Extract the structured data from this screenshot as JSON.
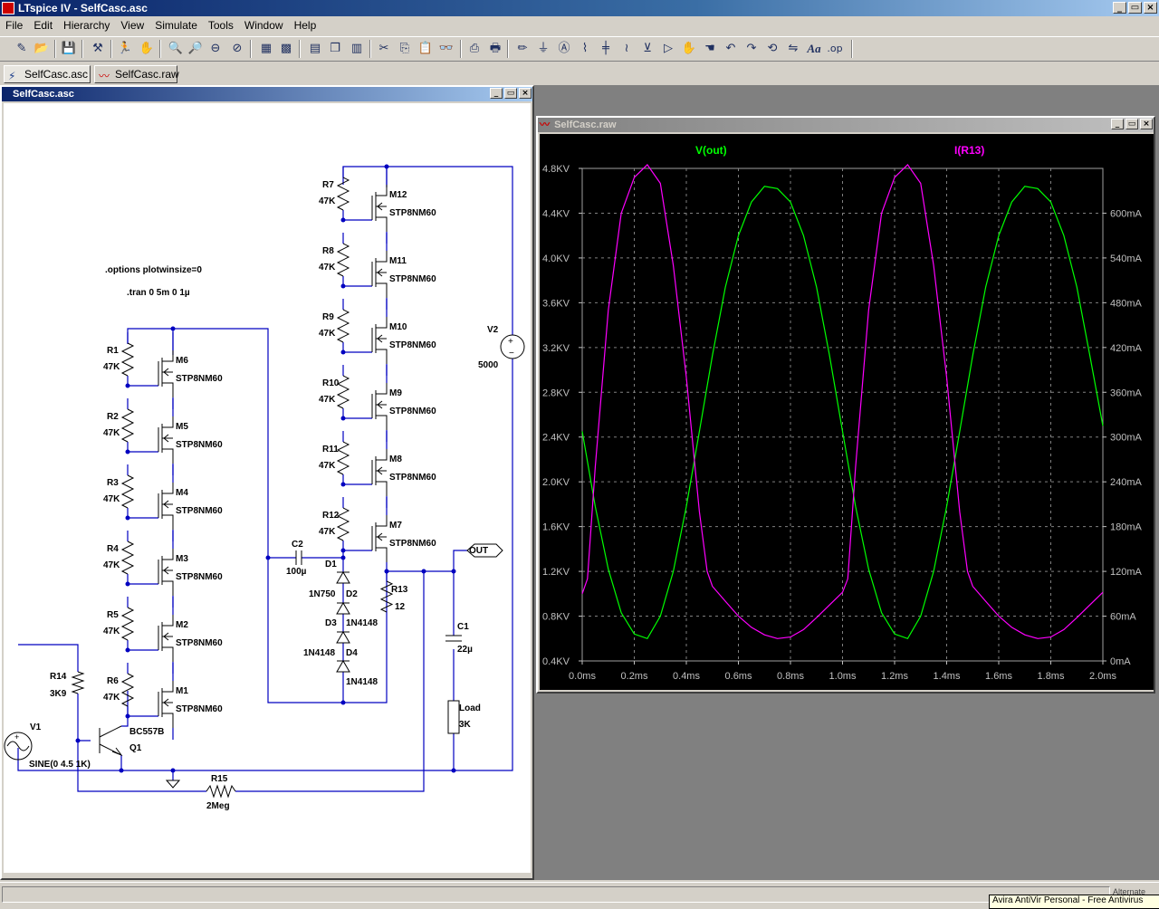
{
  "window": {
    "title": "LTspice IV - SelfCasc.asc",
    "controls": [
      "_",
      "▭",
      "×"
    ]
  },
  "menu": [
    "File",
    "Edit",
    "Hierarchy",
    "View",
    "Simulate",
    "Tools",
    "Window",
    "Help"
  ],
  "toolbar": {
    "buttons": [
      "new-schematic-icon",
      "open-icon",
      "save-icon",
      "control-panel-icon",
      "run-icon",
      "halt-icon",
      "zoom-in-icon",
      "zoom-pan-icon",
      "zoom-out-icon",
      "zoom-cancel-icon",
      "autorange-icon",
      "grid-icon",
      "tile-horizontal-icon",
      "cascade-icon",
      "tile-vertical-icon",
      "cut-icon",
      "copy-icon",
      "paste-icon",
      "find-icon",
      "print-setup-icon",
      "print-icon",
      "wire-icon",
      "ground-icon",
      "label-icon",
      "resistor-icon",
      "capacitor-icon",
      "inductor-icon",
      "diode-icon",
      "component-icon",
      "move-icon",
      "drag-icon",
      "undo-icon",
      "redo-icon",
      "rotate-icon",
      "mirror-icon",
      "text-icon",
      "spice-directive-icon"
    ],
    "text_glyph": "Aa",
    "op_glyph": ".op"
  },
  "tabs": [
    "SelfCasc.asc",
    "SelfCasc.raw"
  ],
  "schematic": {
    "title": "SelfCasc.asc",
    "directives": [
      ".options plotwinsize=0",
      ".tran 0 5m 0 1µ"
    ],
    "left_stack": [
      {
        "r": "R1",
        "rv": "47K",
        "m": "M6",
        "mv": "STP8NM60"
      },
      {
        "r": "R2",
        "rv": "47K",
        "m": "M5",
        "mv": "STP8NM60"
      },
      {
        "r": "R3",
        "rv": "47K",
        "m": "M4",
        "mv": "STP8NM60"
      },
      {
        "r": "R4",
        "rv": "47K",
        "m": "M3",
        "mv": "STP8NM60"
      },
      {
        "r": "R5",
        "rv": "47K",
        "m": "M2",
        "mv": "STP8NM60"
      },
      {
        "r": "R6",
        "rv": "47K",
        "m": "M1",
        "mv": "STP8NM60"
      }
    ],
    "right_stack": [
      {
        "r": "R7",
        "rv": "47K",
        "m": "M12",
        "mv": "STP8NM60"
      },
      {
        "r": "R8",
        "rv": "47K",
        "m": "M11",
        "mv": "STP8NM60"
      },
      {
        "r": "R9",
        "rv": "47K",
        "m": "M10",
        "mv": "STP8NM60"
      },
      {
        "r": "R10",
        "rv": "47K",
        "m": "M9",
        "mv": "STP8NM60"
      },
      {
        "r": "R11",
        "rv": "47K",
        "m": "M8",
        "mv": "STP8NM60"
      },
      {
        "r": "R12",
        "rv": "47K",
        "m": "M7",
        "mv": "STP8NM60"
      }
    ],
    "labels": {
      "v2": "V2",
      "v2_val": "5000",
      "c2": "C2",
      "c2_val": "100µ",
      "d1": "D1",
      "d1_val": "1N750",
      "d2": "D2",
      "d2_val": "1N4148",
      "d3": "D3",
      "d3_val": "1N4148",
      "d4": "D4",
      "d4_val": "1N4148",
      "r13": "R13",
      "r13_val": "12",
      "out": "OUT",
      "c1": "C1",
      "c1_val": "22µ",
      "load": "Load",
      "load_val": "3K",
      "r14": "R14",
      "r14_val": "3K9",
      "v1": "V1",
      "v1_val": "SINE(0 4.5 1K)",
      "q1": "Q1",
      "q1_val": "BC557B",
      "r15": "R15",
      "r15_val": "2Meg"
    }
  },
  "plot": {
    "title": "SelfCasc.raw",
    "trace_names": [
      "V(out)",
      "I(R13)"
    ],
    "trace_colors": [
      "#00ff00",
      "#ff00ff"
    ],
    "left_ticks": [
      "4.8KV",
      "4.4KV",
      "4.0KV",
      "3.6KV",
      "3.2KV",
      "2.8KV",
      "2.4KV",
      "2.0KV",
      "1.6KV",
      "1.2KV",
      "0.8KV",
      "0.4KV"
    ],
    "right_ticks": [
      "600mA",
      "540mA",
      "480mA",
      "420mA",
      "360mA",
      "300mA",
      "240mA",
      "180mA",
      "120mA",
      "60mA",
      "0mA"
    ],
    "x_ticks": [
      "0.0ms",
      "0.2ms",
      "0.4ms",
      "0.6ms",
      "0.8ms",
      "1.0ms",
      "1.2ms",
      "1.4ms",
      "1.6ms",
      "1.8ms",
      "2.0ms"
    ]
  },
  "chart_data": {
    "type": "line",
    "x_unit": "ms",
    "xlim": [
      0,
      2.0
    ],
    "ylim_left": [
      0.4,
      4.8
    ],
    "ylim_right": [
      0,
      660
    ],
    "grid": true,
    "series": [
      {
        "name": "V(out)",
        "axis": "left",
        "unit": "KV",
        "color": "#00ff00",
        "x": [
          0.0,
          0.05,
          0.1,
          0.15,
          0.2,
          0.25,
          0.3,
          0.35,
          0.4,
          0.45,
          0.5,
          0.55,
          0.6,
          0.65,
          0.7,
          0.75,
          0.8,
          0.85,
          0.9,
          0.95,
          1.0,
          1.05,
          1.1,
          1.15,
          1.2,
          1.25,
          1.3,
          1.35,
          1.4,
          1.45,
          1.5,
          1.55,
          1.6,
          1.65,
          1.7,
          1.75,
          1.8,
          1.85,
          1.9,
          1.95,
          2.0
        ],
        "y": [
          2.45,
          1.78,
          1.22,
          0.83,
          0.64,
          0.6,
          0.8,
          1.2,
          1.78,
          2.45,
          3.13,
          3.74,
          4.2,
          4.5,
          4.64,
          4.62,
          4.5,
          4.2,
          3.74,
          3.13,
          2.45,
          1.78,
          1.22,
          0.83,
          0.64,
          0.6,
          0.8,
          1.2,
          1.78,
          2.45,
          3.13,
          3.74,
          4.2,
          4.5,
          4.64,
          4.62,
          4.5,
          4.2,
          3.74,
          3.13,
          2.5
        ]
      },
      {
        "name": "I(R13)",
        "axis": "right",
        "unit": "mA",
        "color": "#ff00ff",
        "x": [
          0.0,
          0.02,
          0.05,
          0.1,
          0.15,
          0.2,
          0.25,
          0.3,
          0.35,
          0.4,
          0.45,
          0.48,
          0.5,
          0.55,
          0.6,
          0.65,
          0.7,
          0.75,
          0.8,
          0.85,
          0.9,
          0.95,
          1.0,
          1.02,
          1.05,
          1.1,
          1.15,
          1.2,
          1.25,
          1.3,
          1.35,
          1.4,
          1.45,
          1.48,
          1.5,
          1.55,
          1.6,
          1.65,
          1.7,
          1.75,
          1.8,
          1.85,
          1.9,
          1.95,
          2.0
        ],
        "y": [
          90,
          110,
          260,
          470,
          600,
          648,
          665,
          640,
          530,
          380,
          200,
          120,
          100,
          80,
          60,
          45,
          35,
          30,
          32,
          42,
          58,
          75,
          92,
          110,
          260,
          470,
          600,
          648,
          665,
          640,
          530,
          380,
          200,
          120,
          100,
          80,
          60,
          45,
          35,
          30,
          32,
          42,
          58,
          75,
          92
        ]
      }
    ]
  },
  "status": {
    "tooltip": "Avira AntiVir Personal - Free Antivirus",
    "tray": "Alternate"
  }
}
